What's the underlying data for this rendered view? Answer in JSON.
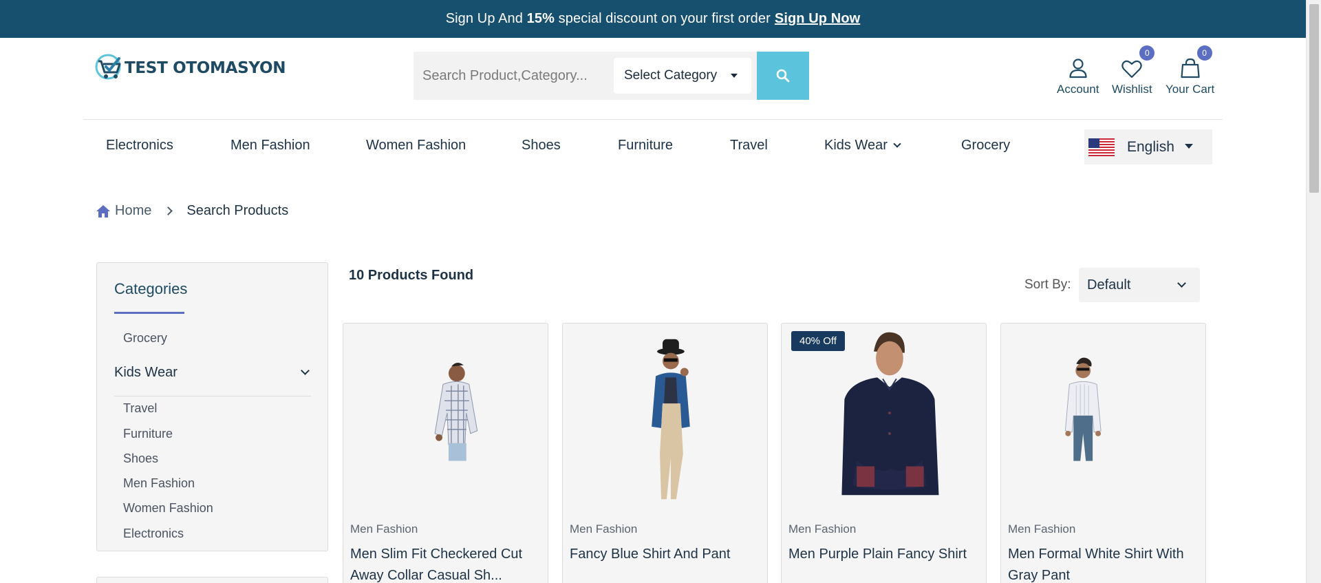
{
  "promo": {
    "text_before": "Sign Up And",
    "discount": "15%",
    "text_after": "special discount on your first order",
    "link": "Sign Up Now"
  },
  "header": {
    "logo_text": "TEST OTOMASYON",
    "search_placeholder": "Search Product,Category...",
    "category_select": "Select Category",
    "account_label": "Account",
    "wishlist_label": "Wishlist",
    "wishlist_count": "0",
    "cart_label": "Your Cart",
    "cart_count": "0"
  },
  "nav": {
    "items": [
      "Electronics",
      "Men Fashion",
      "Women Fashion",
      "Shoes",
      "Furniture",
      "Travel",
      "Kids Wear",
      "Grocery"
    ],
    "language": "English"
  },
  "breadcrumb": {
    "home": "Home",
    "current": "Search Products"
  },
  "sidebar": {
    "title": "Categories",
    "items_top": [
      "Grocery"
    ],
    "expanded": "Kids Wear",
    "items_sub": [
      "Travel",
      "Furniture",
      "Shoes",
      "Men Fashion",
      "Women Fashion",
      "Electronics"
    ]
  },
  "results": {
    "count_text": "10 Products Found",
    "sort_label": "Sort By:",
    "sort_value": "Default",
    "products": [
      {
        "category": "Men Fashion",
        "name": "Men Slim Fit Checkered Cut Away Collar Casual Sh...",
        "badge": ""
      },
      {
        "category": "Men Fashion",
        "name": "Fancy Blue Shirt And Pant",
        "badge": ""
      },
      {
        "category": "Men Fashion",
        "name": "Men Purple Plain Fancy Shirt",
        "badge": "40% Off"
      },
      {
        "category": "Men Fashion",
        "name": "Men Formal White Shirt With Gray Pant",
        "badge": ""
      }
    ]
  },
  "colors": {
    "promo_bg": "#17506f",
    "accent": "#5b6ec2",
    "search_button": "#5bc4dc"
  }
}
